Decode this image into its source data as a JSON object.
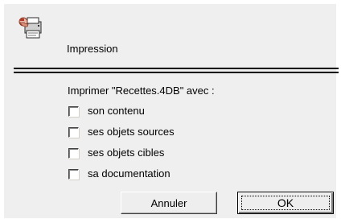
{
  "dialog": {
    "title": "Impression",
    "icon": "printer-with-hand-icon",
    "prompt": "Imprimer \"Recettes.4DB\" avec :"
  },
  "options": [
    {
      "label": "son contenu",
      "checked": false
    },
    {
      "label": "ses objets sources",
      "checked": false
    },
    {
      "label": "ses objets cibles",
      "checked": false
    },
    {
      "label": "sa documentation",
      "checked": false
    }
  ],
  "buttons": {
    "cancel": "Annuler",
    "ok": "OK"
  },
  "colors": {
    "background": "#efefef",
    "page": "#ffffff",
    "separator": "#000000"
  }
}
